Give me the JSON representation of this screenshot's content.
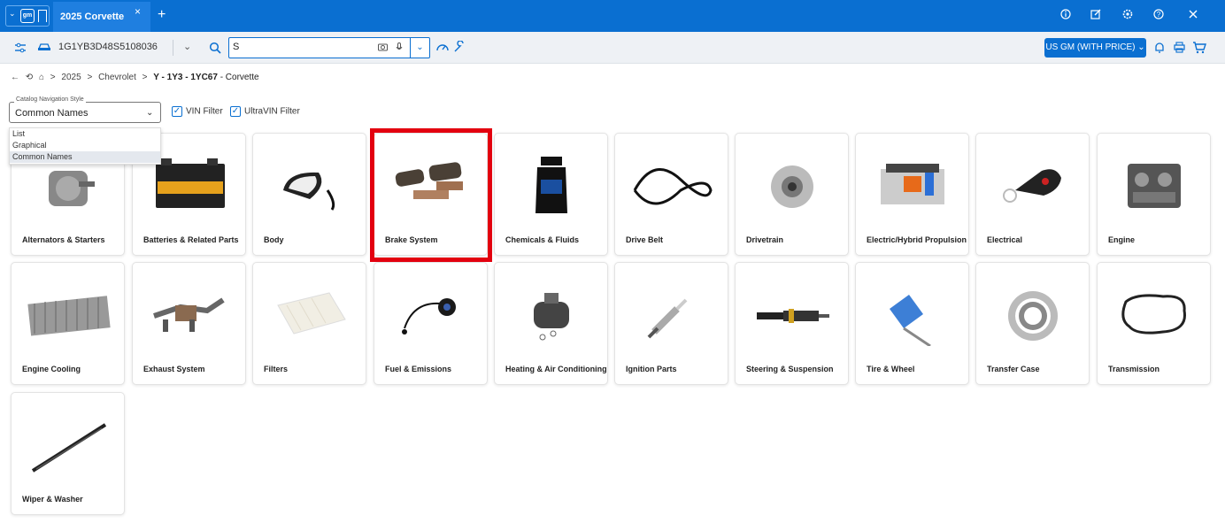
{
  "app": {
    "tab_title": "2025 Corvette",
    "tab_close": "×",
    "new_tab": "+",
    "logo_text": "gm",
    "menu_chevron": "⌄"
  },
  "title_icons": [
    "info-icon",
    "edit-icon",
    "settings-icon",
    "help-icon",
    "close-icon"
  ],
  "toolbar": {
    "vin": "1G1YB3D48S5108036",
    "search_value": "S",
    "catalog_label": "US GM (WITH PRICE) ⌄"
  },
  "breadcrumb": {
    "back": "←",
    "history": "⟲",
    "home": "⌂",
    "sep": ">",
    "year": "2025",
    "make": "Chevrolet",
    "model_prefix": "Y - 1Y3 - 1YC67",
    "model_suffix": " - Corvette"
  },
  "filters": {
    "nav_style_legend": "Catalog Navigation Style",
    "nav_style_value": "Common Names",
    "vin_filter": "VIN Filter",
    "ultravin_filter": "UltraVIN Filter"
  },
  "dropdown_options": [
    {
      "label": "List",
      "selected": false
    },
    {
      "label": "Graphical",
      "selected": false
    },
    {
      "label": "Common Names",
      "selected": true
    }
  ],
  "categories": [
    "Alternators & Starters",
    "Batteries & Related Parts",
    "Body",
    "Brake System",
    "Chemicals & Fluids",
    "Drive Belt",
    "Drivetrain",
    "Electric/Hybrid Propulsion",
    "Electrical",
    "Engine",
    "Engine Cooling",
    "Exhaust System",
    "Filters",
    "Fuel & Emissions",
    "Heating & Air Conditioning",
    "Ignition Parts",
    "Steering & Suspension",
    "Tire & Wheel",
    "Transfer Case",
    "Transmission",
    "Wiper & Washer"
  ],
  "highlighted_category": "Brake System",
  "colors": {
    "brand": "#0a6fd1",
    "highlight": "#e3000f"
  }
}
